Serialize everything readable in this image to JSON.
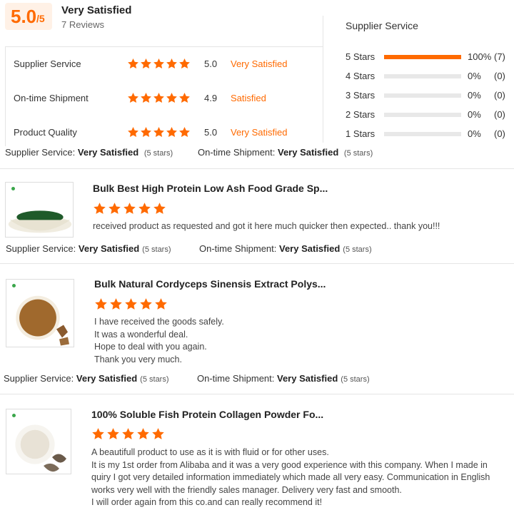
{
  "summary": {
    "score": "5.0",
    "score_of": "/5",
    "label": "Very Satisfied",
    "reviews": "7 Reviews"
  },
  "metrics": [
    {
      "label": "Supplier Service",
      "rating": 5,
      "score": "5.0",
      "text": "Very Satisfied"
    },
    {
      "label": "On-time Shipment",
      "rating": 5,
      "score": "4.9",
      "text": "Satisfied"
    },
    {
      "label": "Product Quality",
      "rating": 5,
      "score": "5.0",
      "text": "Very Satisfied"
    }
  ],
  "distribution": {
    "title": "Supplier Service",
    "rows": [
      {
        "label": "5 Stars",
        "fraction": 1.0,
        "pct": "100%",
        "count": "(7)"
      },
      {
        "label": "4 Stars",
        "fraction": 0,
        "pct": "0%",
        "count": "(0)"
      },
      {
        "label": "3 Stars",
        "fraction": 0,
        "pct": "0%",
        "count": "(0)"
      },
      {
        "label": "2 Stars",
        "fraction": 0,
        "pct": "0%",
        "count": "(0)"
      },
      {
        "label": "1 Stars",
        "fraction": 0,
        "pct": "0%",
        "count": "(0)"
      }
    ]
  },
  "summary_service": {
    "supplier_label": "Supplier Service:",
    "supplier_value": "Very Satisfied",
    "supplier_stars": "(5 stars)",
    "shipment_label": "On-time Shipment:",
    "shipment_value": "Very Satisfied",
    "shipment_stars": "(5 stars)"
  },
  "reviews": [
    {
      "title": "Bulk Best High Protein Low Ash Food Grade Sp...",
      "rating": 5,
      "lines": [
        "received product as requested and got it here much quicker then expected.. thank you!!!"
      ],
      "supplier_label": "Supplier Service:",
      "supplier_value": "Very Satisfied",
      "supplier_stars": "(5 stars)",
      "shipment_label": "On-time Shipment:",
      "shipment_value": "Very Satisfied",
      "shipment_stars": "(5 stars)",
      "image_color": "#1f5a2a"
    },
    {
      "title": "Bulk Natural Cordyceps Sinensis Extract Polys...",
      "rating": 5,
      "lines": [
        "I have received the goods safely.",
        "It was a wonderful deal.",
        "Hope to deal with you again.",
        "Thank you very much."
      ],
      "supplier_label": "Supplier Service:",
      "supplier_value": "Very Satisfied",
      "supplier_stars": "(5 stars)",
      "shipment_label": "On-time Shipment:",
      "shipment_value": "Very Satisfied",
      "shipment_stars": "(5 stars)",
      "image_color": "#a0692d"
    },
    {
      "title": "100% Soluble Fish Protein Collagen Powder Fo...",
      "rating": 5,
      "lines": [
        "A beautifull product to use as it is with fluid or for other uses.",
        "It is my 1st order from Alibaba and it was a very good experience with this company. When I made in",
        "quiry I got very detailed information immediately which made all very easy. Communication in English",
        "works very well with the friendly sales manager. Delivery very fast and smooth.",
        "I will order again from this co.and can really recommend it!"
      ],
      "image_color": "#e8e2d6"
    }
  ],
  "colors": {
    "accent": "#ff6a00",
    "star": "#ff6a00"
  }
}
